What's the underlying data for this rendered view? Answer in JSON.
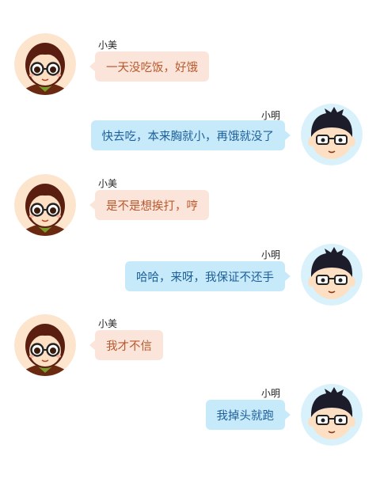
{
  "colors": {
    "girl_bubble": "#fbe5da",
    "girl_text": "#b9592d",
    "boy_bubble": "#c7eafa",
    "boy_text": "#1d5f9a"
  },
  "messages": [
    {
      "sender": "小美",
      "side": "left",
      "avatar": "girl-avatar-icon",
      "text": "一天没吃饭，好饿"
    },
    {
      "sender": "小明",
      "side": "right",
      "avatar": "boy-avatar-icon",
      "text": "快去吃，本来胸就小，再饿就没了"
    },
    {
      "sender": "小美",
      "side": "left",
      "avatar": "girl-avatar-icon",
      "text": "是不是想挨打，哼"
    },
    {
      "sender": "小明",
      "side": "right",
      "avatar": "boy-avatar-icon",
      "text": "哈哈，来呀，我保证不还手"
    },
    {
      "sender": "小美",
      "side": "left",
      "avatar": "girl-avatar-icon",
      "text": "我才不信"
    },
    {
      "sender": "小明",
      "side": "right",
      "avatar": "boy-avatar-icon",
      "text": "我掉头就跑"
    }
  ]
}
